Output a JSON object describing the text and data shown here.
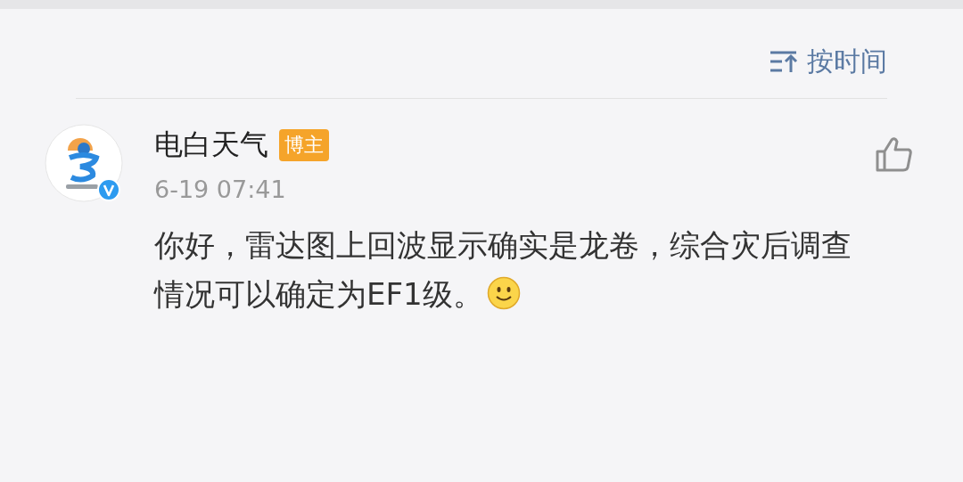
{
  "sort_button": {
    "label": "按时间"
  },
  "comments": [
    {
      "author": "电白天气",
      "verified": true,
      "badge": "博主",
      "time": "6-19 07:41",
      "text": "你好，雷达图上回波显示确实是龙卷，综合灾后调查情况可以确定为EF1级。",
      "emoji": true,
      "liked": false
    }
  ]
}
